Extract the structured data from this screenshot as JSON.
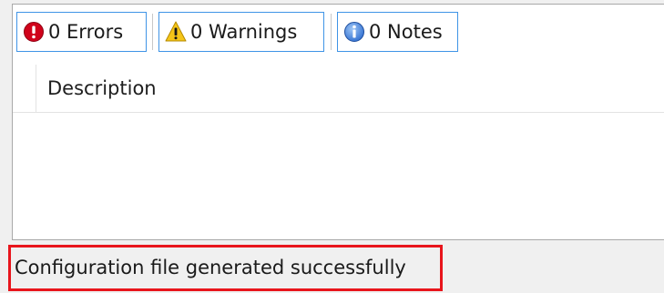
{
  "toolbar": {
    "errors": {
      "label": "0 Errors",
      "icon": "error-icon"
    },
    "warnings": {
      "label": "0 Warnings",
      "icon": "warning-icon"
    },
    "notes": {
      "label": "0 Notes",
      "icon": "info-icon"
    }
  },
  "table": {
    "columns": [
      "Description"
    ],
    "rows": []
  },
  "status": {
    "message": "Configuration file generated successfully",
    "highlight_color": "#e8151c"
  },
  "colors": {
    "button_border": "#3f94e6",
    "error": "#d0021b",
    "warning": "#f5c518",
    "info": "#2f6fd1"
  }
}
